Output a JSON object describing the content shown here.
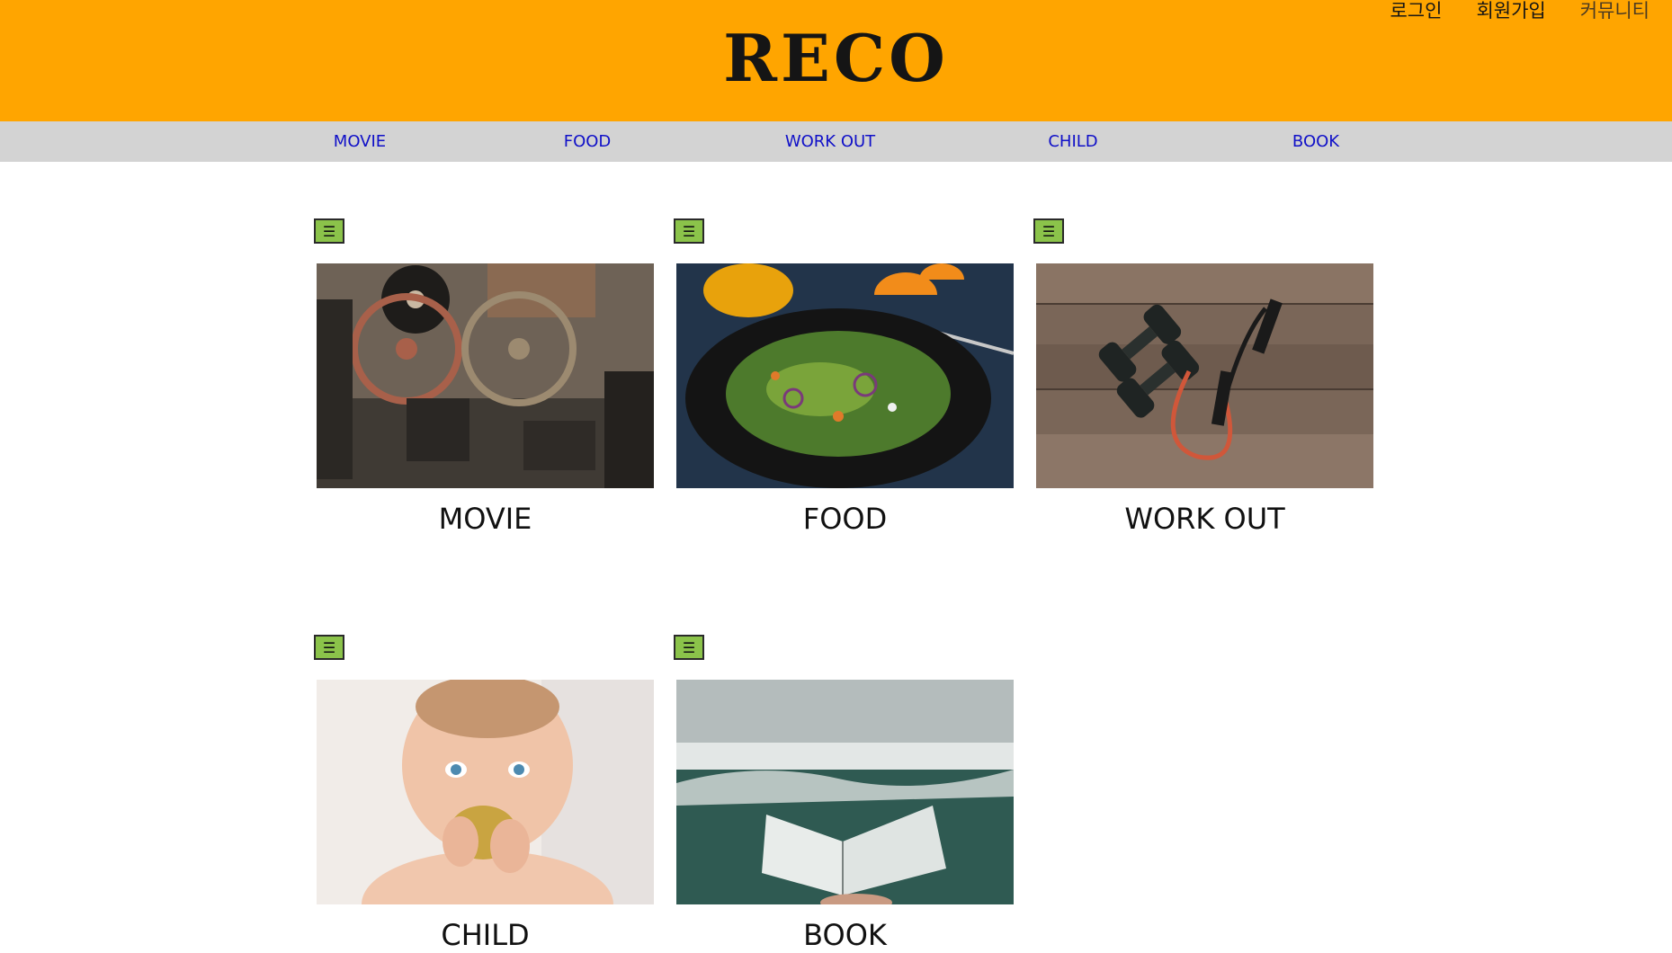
{
  "header": {
    "logo": "RECO",
    "links": [
      "로그인",
      "회원가입",
      "커뮤니티"
    ]
  },
  "nav": {
    "items": [
      "MOVIE",
      "FOOD",
      "WORK OUT",
      "CHILD",
      "BOOK"
    ]
  },
  "cards": [
    {
      "title": "MOVIE",
      "menu_icon": "☰",
      "image": "film-projector-reels"
    },
    {
      "title": "FOOD",
      "menu_icon": "☰",
      "image": "salad-plate-orange-juice"
    },
    {
      "title": "WORK OUT",
      "menu_icon": "☰",
      "image": "dumbbells-resistance-band"
    },
    {
      "title": "CHILD",
      "menu_icon": "☰",
      "image": "baby-eating"
    },
    {
      "title": "BOOK",
      "menu_icon": "☰",
      "image": "open-book-forest"
    }
  ],
  "colors": {
    "header": "#ffa500",
    "nav_bg": "#d3d3d3",
    "nav_text": "#1010c8",
    "menu_button": "#8bc34a"
  }
}
